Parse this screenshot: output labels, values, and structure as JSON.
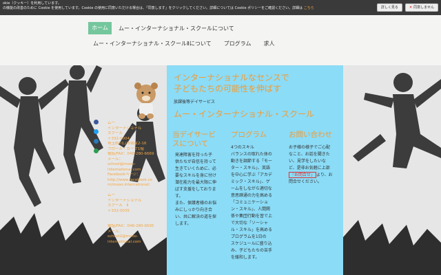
{
  "cookie": {
    "line1": "okie（クッキー）を利用しています。",
    "line2": "の機能の改善のために Cookie を使用しています。Cookie の使用に同意いただける場合は、「同意します」をクリックしてください。詳細については Cookie ポリシーをご確認ください。詳細は",
    "link": "こちら",
    "detail_button": "詳しく見る",
    "decline_button": "同意しません"
  },
  "nav": {
    "home": "ホーム",
    "about": "ムー・インターナショナル・スクールについて",
    "about2": "ムー・インターナショナル・スクールⅡについて",
    "program": "プログラム",
    "jobs": "求人"
  },
  "contact": [
    "ムー",
    "インターナショナル",
    "スクール",
    "〒332-0004",
    "埼玉県川口市領家2-16",
    "フロール・カーサ1階",
    "電話/FAX：048-280-6669",
    "メール：",
    "school@mooo-",
    "international.com",
    "Facebookページ：",
    "http://www.facebook.co",
    "m/mooo.international/",
    "",
    "ムー",
    "インターナショナル",
    "スクール　Ⅱ",
    "〒332-0035",
    "",
    "",
    "電話/FAX：048-280-6695",
    "メール：",
    "school2@mooo-",
    "international.com"
  ],
  "panel": {
    "title_line1": "インターナショナルなセンスで",
    "title_line2": "子どもたちの可能性を伸ばす",
    "subtitle": "放課後等デイサービス",
    "school": "ムー・インターナショナル・スクール",
    "col1": {
      "head_line1": "当デイサービ",
      "head_line2": "スについて",
      "text": [
        "発達障害を持った子",
        "供たちが自信を持って",
        "生きていくために、必",
        "要なスキルを身に付け",
        "潜在能力を最大限に伸",
        "ばす支援をしておりま",
        "す。",
        "また、保護者様のお悩",
        "みにしっかり向き合",
        "い、共に解決の道を探",
        "します。"
      ]
    },
    "col2": {
      "head": "プログラム",
      "text": [
        "4つのスキル",
        "バランスの取れた体の",
        "動きを調節する「モー",
        "ター・スキル」、英語",
        "を中心に学ぶ「アカデ",
        "ミック・スキル」、ゲ",
        "ームをしながら適切な",
        "意思疎通の力を高める",
        "「コミュニケーショ",
        "ン・スキル」、人間関",
        "係や集団行動を習で上",
        "で大切な「ソーシャ",
        "ル・スキル」を高める",
        "プログラムを1日の",
        "スケジュールに盛り込",
        "み、子どもたちの苦手",
        "を緩和します。"
      ]
    },
    "col3": {
      "head": "お問い合わせ",
      "text_before": [
        "お子様の様子でご心配",
        "なこと、お話を聞きた",
        "い、見学をしたいな",
        "ど、是非お気軽に上部"
      ],
      "highlight": "「お問合せ」",
      "text_after": "より、お",
      "text_end": "問合せください。"
    }
  }
}
